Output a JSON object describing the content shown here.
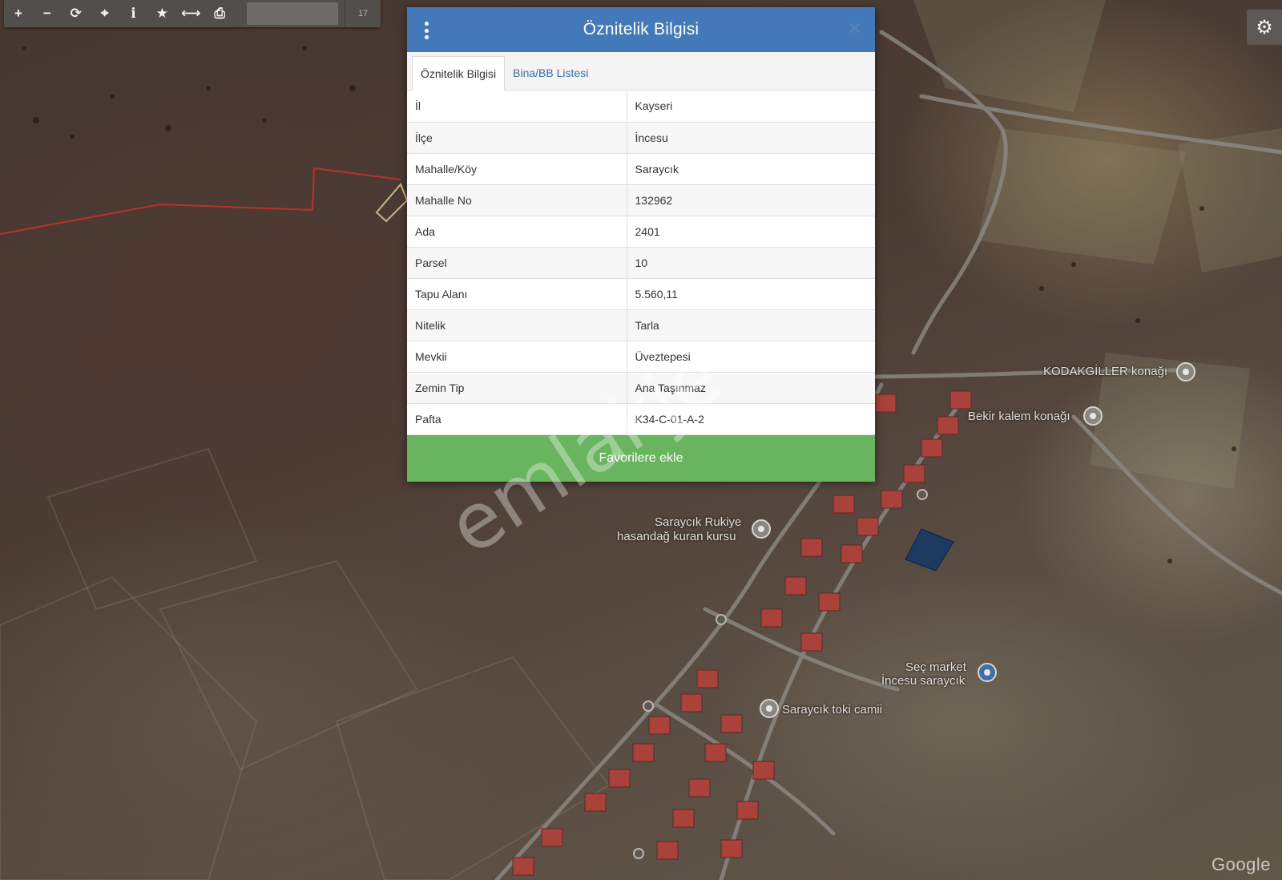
{
  "toolbar": {
    "tools": [
      {
        "name": "zoom-in",
        "glyph": "+"
      },
      {
        "name": "zoom-out",
        "glyph": "−"
      },
      {
        "name": "refresh",
        "glyph": "⟳"
      },
      {
        "name": "locate",
        "glyph": "⌖"
      },
      {
        "name": "info",
        "glyph": "i"
      },
      {
        "name": "favorite",
        "glyph": "★"
      },
      {
        "name": "measure",
        "glyph": "⟷"
      },
      {
        "name": "print",
        "glyph": "⎙"
      }
    ],
    "zoom_level": "17"
  },
  "settings_icon": "⚙",
  "dialog": {
    "title": "Öznitelik Bilgisi",
    "close_glyph": "✕",
    "tabs": [
      {
        "label": "Öznitelik Bilgisi",
        "active": true
      },
      {
        "label": "Bina/BB Listesi",
        "active": false
      }
    ],
    "rows": [
      {
        "key": "İl",
        "value": "Kayseri"
      },
      {
        "key": "İlçe",
        "value": "İncesu"
      },
      {
        "key": "Mahalle/Köy",
        "value": "Saraycık"
      },
      {
        "key": "Mahalle No",
        "value": "132962"
      },
      {
        "key": "Ada",
        "value": "2401"
      },
      {
        "key": "Parsel",
        "value": "10"
      },
      {
        "key": "Tapu Alanı",
        "value": "5.560,11"
      },
      {
        "key": "Nitelik",
        "value": "Tarla"
      },
      {
        "key": "Mevkii",
        "value": "Üveztepesi"
      },
      {
        "key": "Zemin Tip",
        "value": "Ana Taşınmaz"
      },
      {
        "key": "Pafta",
        "value": "K34-C-01-A-2"
      }
    ],
    "favorite_button": "Favorilere ekle"
  },
  "map": {
    "labels": {
      "kodakgiller": "KODAKGİLLER konağı",
      "bekir": "Bekir kalem konağı",
      "kuran_line1": "Saraycık Rukiye",
      "kuran_line2": "hasandağ kuran kursu",
      "market_line1": "Seç market",
      "market_line2": "İncesu saraycık",
      "camii": "Saraycık toki camii"
    },
    "attribution": "Google",
    "watermark": "emlakje"
  }
}
